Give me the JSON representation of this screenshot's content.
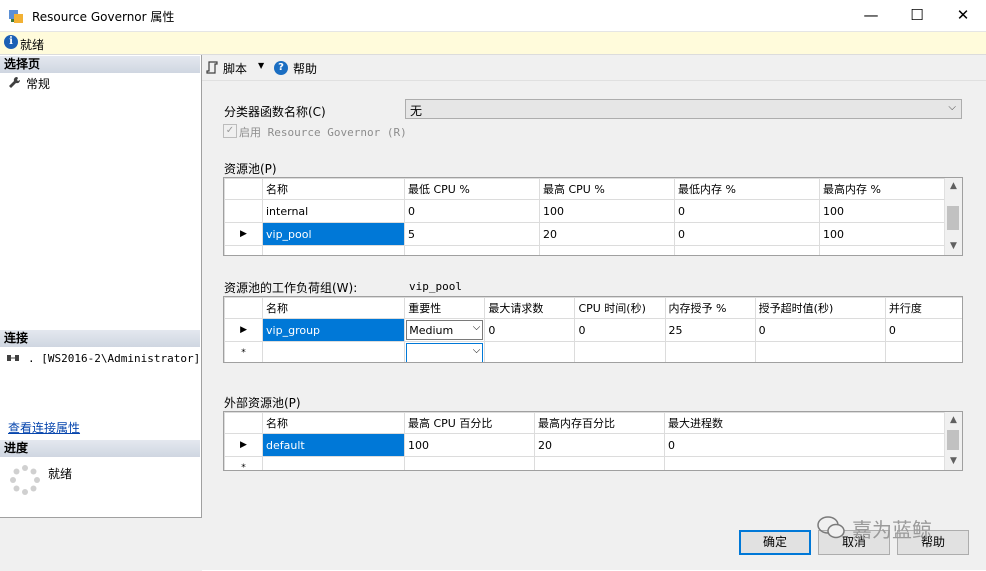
{
  "window": {
    "title": "Resource Governor 属性",
    "minimize": "—",
    "maximize": "☐",
    "close": "✕"
  },
  "status_bar": {
    "text": "就绪"
  },
  "left_panel": {
    "select_page_header": "选择页",
    "pages": [
      {
        "label": "常规"
      }
    ],
    "connection_header": "连接",
    "connection_text": ". [WS2016-2\\Administrator]",
    "view_connection_link": "查看连接属性",
    "progress_header": "进度",
    "progress_text": "就绪"
  },
  "toolbar": {
    "script_label": "脚本",
    "help_label": "帮助"
  },
  "form": {
    "classifier_label": "分类器函数名称(C)",
    "classifier_value": "无",
    "enable_label": "启用 Resource Governor (R)",
    "enable_checked": true
  },
  "resource_pools": {
    "label": "资源池(P)",
    "columns": [
      "名称",
      "最低 CPU %",
      "最高 CPU %",
      "最低内存 %",
      "最高内存 %"
    ],
    "rows": [
      [
        "internal",
        "0",
        "100",
        "0",
        "100"
      ],
      [
        "vip_pool",
        "5",
        "20",
        "0",
        "100"
      ]
    ]
  },
  "workload_groups": {
    "label": "资源池的工作负荷组(W):",
    "pool_name": "vip_pool",
    "columns": [
      "名称",
      "重要性",
      "最大请求数",
      "CPU 时间(秒)",
      "内存授予 %",
      "授予超时值(秒)",
      "并行度"
    ],
    "rows": [
      [
        "vip_group",
        "Medium",
        "0",
        "0",
        "25",
        "0",
        "0"
      ]
    ]
  },
  "external_pools": {
    "label": "外部资源池(P)",
    "columns": [
      "名称",
      "最高 CPU 百分比",
      "最高内存百分比",
      "最大进程数"
    ],
    "rows": [
      [
        "default",
        "100",
        "20",
        "0"
      ]
    ]
  },
  "buttons": {
    "ok": "确定",
    "cancel": "取消",
    "help": "帮助"
  },
  "watermark": {
    "text": "嘉为蓝鲸"
  },
  "colors": {
    "selection": "#0078d7",
    "status_bg": "#fffbdb",
    "accent": "#0078d7"
  }
}
